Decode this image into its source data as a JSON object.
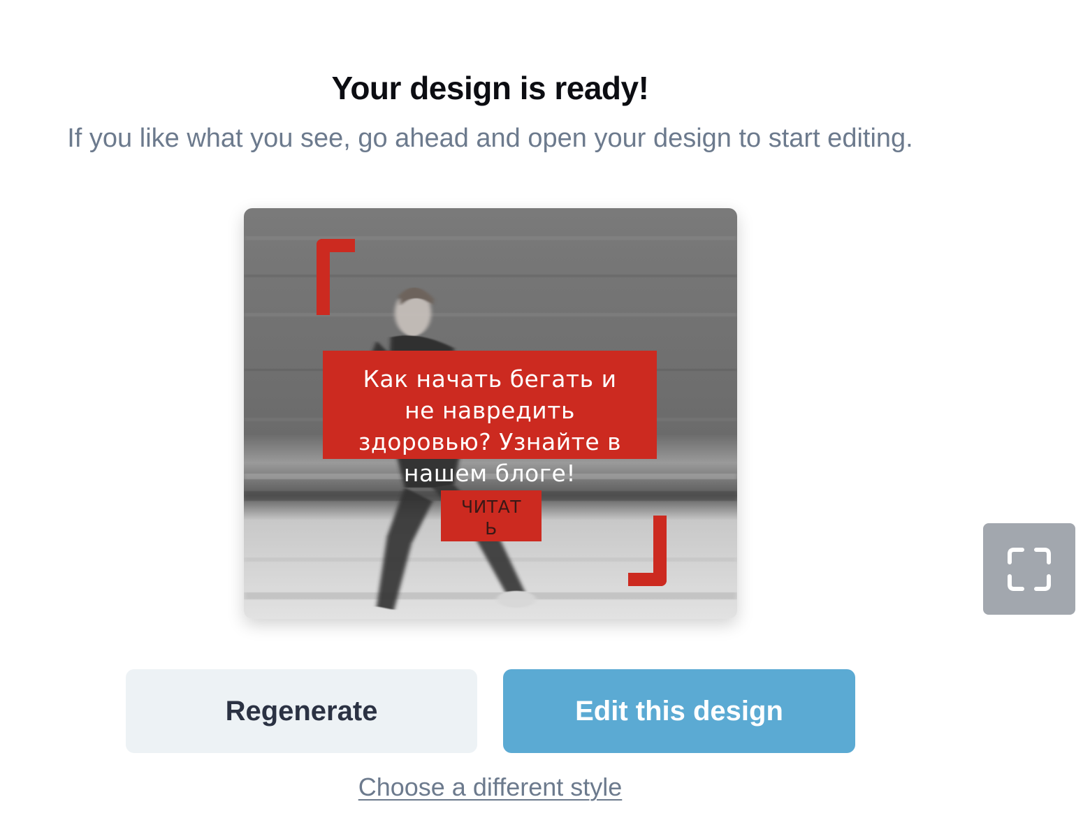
{
  "header": {
    "title": "Your design is ready!",
    "subtitle": "If you like what you see, go ahead and open your design to start editing."
  },
  "preview": {
    "headline": "Как начать бегать и\nне навредить\nздоровью? Узнайте в\nнашем блоге!",
    "cta": "ЧИТАТ\nЬ",
    "accent_color": "#cc2a20"
  },
  "actions": {
    "regenerate_label": "Regenerate",
    "edit_label": "Edit this design",
    "style_link": "Choose a different style",
    "fullscreen_icon": "fullscreen-icon"
  },
  "colors": {
    "edit_button": "#5baad3",
    "regenerate_button": "#edf2f5",
    "subtitle_text": "#6c7a8d",
    "fullscreen_button": "#a2a7ae"
  }
}
